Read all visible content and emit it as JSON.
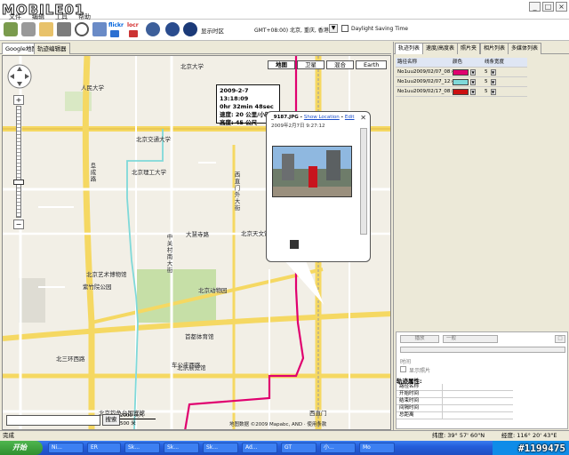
{
  "app": {
    "logo_text": "MOBILE01",
    "menu": [
      "文件",
      "编辑",
      "工具",
      "帮助"
    ]
  },
  "toolbar": {
    "flickr": "flickr",
    "locr": "locr",
    "display_timezone": "显示时区",
    "timezone_value": "GMT+08:00) 北京, 重庆, 香港特",
    "daylight_saving": "Daylight Saving Time"
  },
  "left_tabs": [
    "Google地图",
    "轨迹编辑器"
  ],
  "map": {
    "type_buttons": [
      "地图",
      "卫星",
      "混合",
      "Earth"
    ],
    "speed_callout": {
      "time": "2009-2-7 13:18:09",
      "duration": "0hr 32min 48sec",
      "speed": "速度: 20 公里/小时",
      "altitude": "高度: 45 公尺"
    },
    "photo": {
      "filename": "_9187.JPG",
      "show_location": "Show Location",
      "edit": "Edit",
      "date": "2009年2月7日  9:27:12"
    },
    "labels": {
      "l1": "北京西站",
      "l2": "人民大学",
      "l3": "北京大学",
      "l4": "北京交通大学",
      "l5": "北京动物园",
      "l6": "北京理工大学",
      "l7": "西直门",
      "l8": "大慧寺路",
      "l9": "北三环西路",
      "l10": "北京天文馆",
      "l11": "北京艺术博物馆",
      "l12": "紫竹院公园",
      "l13": "中关村南大街",
      "l14": "首都体育馆",
      "l15": "北京展览馆",
      "l16": "车公庄西路",
      "l17": "阜成路",
      "l18": "西直门外大街",
      "l19": "北京钓鱼台国宾馆"
    },
    "search_button": "搜索",
    "scale_top": "2000 英尺",
    "scale_bottom": "500 米",
    "attribution": "地图数据 ©2009 Mapabc, AND · 使用条款"
  },
  "right_tabs": [
    "轨迹列表",
    "速度/高度表",
    "照片夹",
    "相片列表",
    "多媒体列表"
  ],
  "track_table": {
    "headers": [
      "路径名称",
      "颜色",
      "线条宽度"
    ],
    "rows": [
      {
        "name": "No1uu2009/02/07_08:45",
        "color": "#e0006f",
        "width": "5"
      },
      {
        "name": "No1uu2009/02/07_12:45",
        "color": "#7fd9d9",
        "width": "5"
      },
      {
        "name": "No1uu2009/02/17_08:17",
        "color": "#cc1010",
        "width": "5"
      }
    ]
  },
  "right_body": {
    "play": "播放",
    "step": "一般",
    "time_label": "时间",
    "show_photos": "显示照片",
    "props_title": "轨迹属性:",
    "props": [
      "路径名称",
      "开始时间",
      "结束时间",
      "间隔时间",
      "总距离"
    ]
  },
  "statusbar": {
    "status": "完成",
    "latitude": "纬度: 39° 57' 60\"N",
    "longitude": "经度: 116° 20' 43\"E"
  },
  "taskbar": {
    "start": "开始",
    "tasks": [
      "Ni...",
      "ER",
      "Sk...",
      "Sk...",
      "Sk...",
      "Ad...",
      "GT",
      "小...",
      "Mo"
    ],
    "watermark": "#1199475"
  },
  "colors": {
    "track_pink": "#e0006f",
    "track_teal": "#7fd9d9",
    "road_yellow": "#f5d862",
    "park_green": "#c6dfa7"
  }
}
